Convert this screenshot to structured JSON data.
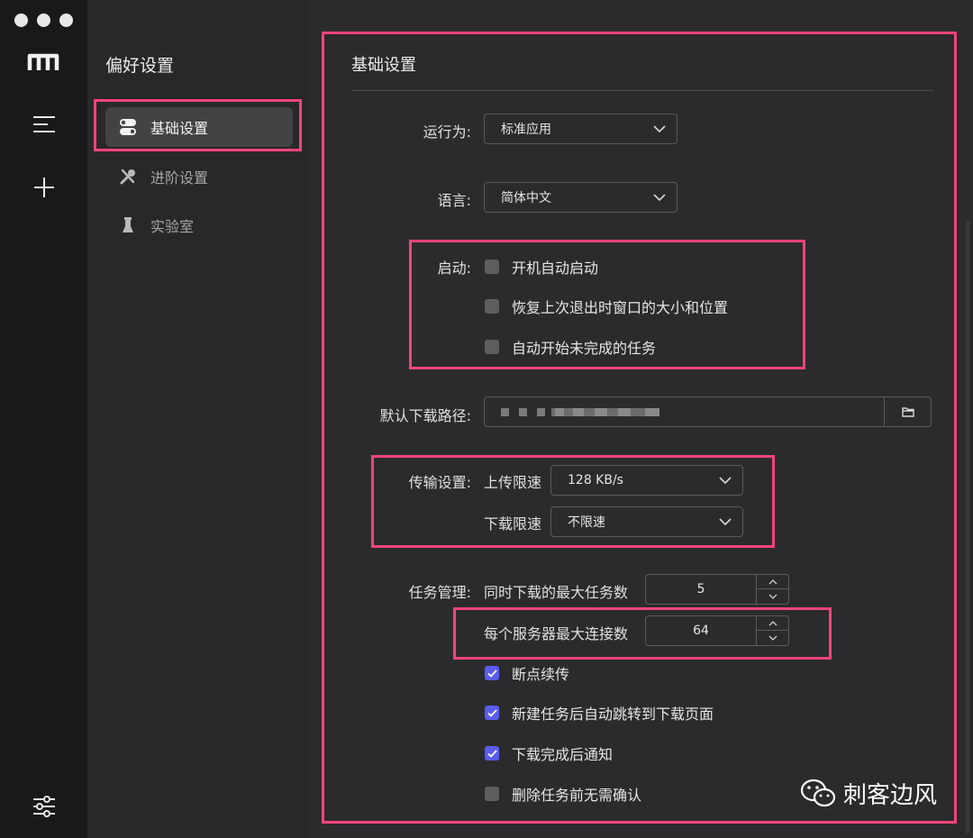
{
  "nav": {
    "title": "偏好设置",
    "items": [
      {
        "label": "基础设置",
        "icon": "toggle-icon"
      },
      {
        "label": "进阶设置",
        "icon": "wrench-screwdriver-icon"
      },
      {
        "label": "实验室",
        "icon": "flask-icon"
      }
    ]
  },
  "main": {
    "title": "基础设置",
    "run_as": {
      "label": "运行为:",
      "value": "标准应用"
    },
    "language": {
      "label": "语言:",
      "value": "简体中文"
    },
    "startup": {
      "label": "启动:",
      "options": [
        {
          "label": "开机自动启动",
          "checked": false
        },
        {
          "label": "恢复上次退出时窗口的大小和位置",
          "checked": false
        },
        {
          "label": "自动开始未完成的任务",
          "checked": false
        }
      ]
    },
    "download_path": {
      "label": "默认下载路径:"
    },
    "transfer": {
      "label": "传输设置:",
      "upload_label": "上传限速",
      "upload_value": "128 KB/s",
      "download_label": "下载限速",
      "download_value": "不限速"
    },
    "tasks": {
      "label": "任务管理:",
      "max_tasks_label": "同时下载的最大任务数",
      "max_tasks_value": "5",
      "max_conn_label": "每个服务器最大连接数",
      "max_conn_value": "64",
      "options": [
        {
          "label": "断点续传",
          "checked": true
        },
        {
          "label": "新建任务后自动跳转到下载页面",
          "checked": true
        },
        {
          "label": "下载完成后通知",
          "checked": true
        },
        {
          "label": "删除任务前无需确认",
          "checked": false
        }
      ]
    }
  },
  "watermark": {
    "text": "刺客边风",
    "icon": "wechat-icon"
  },
  "colors": {
    "accent": "#5a5cf0",
    "highlight": "#f2447a"
  }
}
